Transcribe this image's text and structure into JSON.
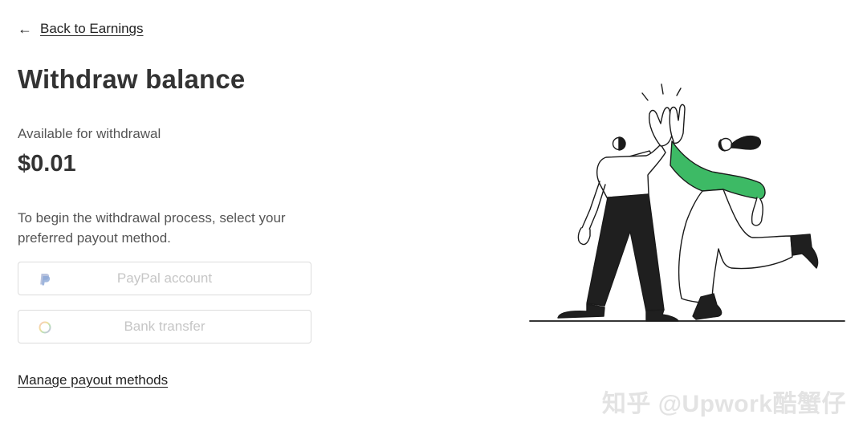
{
  "nav": {
    "back_label": "Back to Earnings"
  },
  "page": {
    "title": "Withdraw balance",
    "available_label": "Available for withdrawal",
    "balance": "$0.01",
    "instructions": "To begin the withdrawal process, select your preferred payout method."
  },
  "payout_methods": {
    "paypal_label": "PayPal account",
    "paypal_icon": "paypal-icon",
    "bank_label": "Bank transfer",
    "bank_icon": "bank-ring-icon",
    "manage_label": "Manage payout methods"
  },
  "illustration": {
    "name": "high-five-illustration",
    "accent_color": "#3dba65"
  },
  "watermark": {
    "text": "知乎 @Upwork酷蟹仔"
  },
  "colors": {
    "text_primary": "#333333",
    "text_secondary": "#555555",
    "disabled_text": "#c6c6c6",
    "border": "#dcdcdc"
  }
}
